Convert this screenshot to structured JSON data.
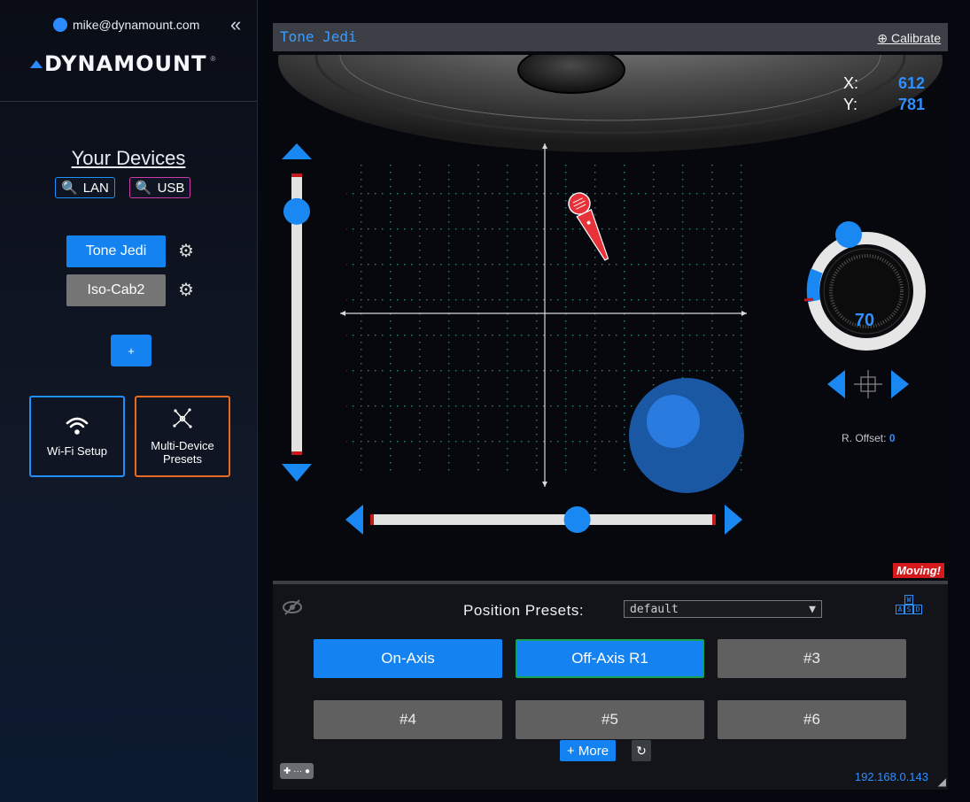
{
  "user": {
    "email": "mike@dynamount.com"
  },
  "brand": {
    "logo_text": "DYNAMOUNT",
    "reg": "®"
  },
  "sidebar": {
    "devices_title": "Your Devices",
    "search": {
      "lan": "LAN",
      "usb": "USB"
    },
    "devices": [
      {
        "label": "Tone Jedi",
        "active": true
      },
      {
        "label": "Iso-Cab2",
        "active": false
      }
    ],
    "add_label": "+",
    "wifi_label": "Wi-Fi Setup",
    "multi_label": "Multi-Device Presets"
  },
  "main": {
    "title": "Tone Jedi",
    "calibrate": "⊕ Calibrate",
    "coords": {
      "x_label": "X:",
      "x": "612",
      "y_label": "Y:",
      "y": "781"
    },
    "rotation": "70",
    "r_offset_label": "R. Offset:",
    "r_offset": "0",
    "status": "Moving!",
    "vertical_slider": 0.13,
    "horizontal_slider": 0.6
  },
  "presets": {
    "label": "Position Presets:",
    "selected": "default",
    "buttons": [
      "On-Axis",
      "Off-Axis R1",
      "#3",
      "#4",
      "#5",
      "#6"
    ],
    "more": "+ More",
    "reset_icon": "↻",
    "ip": "192.168.0.143",
    "wasd": [
      "W",
      "A",
      "S",
      "D"
    ]
  },
  "colors": {
    "accent": "#1482f0",
    "moving": "#d41a1a",
    "lan": "#1f8fff",
    "usb": "#cc3aa8",
    "multi": "#e86a1f"
  }
}
